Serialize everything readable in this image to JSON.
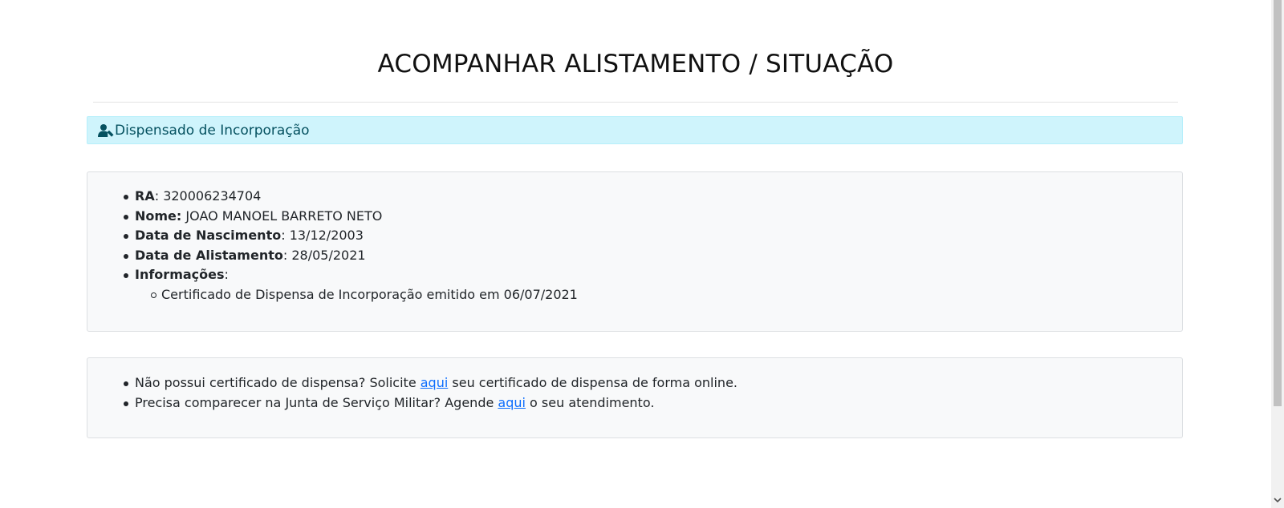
{
  "page": {
    "title": "ACOMPANHAR ALISTAMENTO / SITUAÇÃO"
  },
  "status_alert": {
    "icon": "user-check-icon",
    "text": "Dispensado de Incorporação",
    "colors": {
      "background": "#cff4fc",
      "text": "#055160"
    }
  },
  "details": {
    "ra_label": "RA",
    "ra_value": "320006234704",
    "nome_label": "Nome:",
    "nome_value": "JOAO MANOEL BARRETO NETO",
    "nascimento_label": "Data de Nascimento",
    "nascimento_value": "13/12/2003",
    "alistamento_label": "Data de Alistamento",
    "alistamento_value": "28/05/2021",
    "informacoes_label": "Informações",
    "informacoes_items": [
      "Certificado de Dispensa de Incorporação emitido em 06/07/2021"
    ]
  },
  "links_card": {
    "item1_before": "Não possui certificado de dispensa? Solicite ",
    "item1_link": "aqui",
    "item1_after": " seu certificado de dispensa de forma online.",
    "item2_before": "Precisa comparecer na Junta de Serviço Militar? Agende ",
    "item2_link": "aqui",
    "item2_after": " o seu atendimento.",
    "link_color": "#0d6efd"
  }
}
